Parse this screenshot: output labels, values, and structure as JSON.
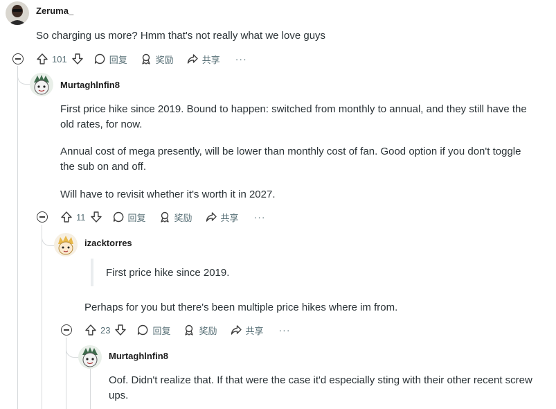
{
  "comments": [
    {
      "username": "Zeruma_",
      "paragraphs": [
        "So charging us more? Hmm that's not really what we love guys"
      ],
      "score": "101"
    },
    {
      "username": "Murtaghlnfin8",
      "paragraphs": [
        "First price hike since 2019. Bound to happen: switched from monthly to annual, and they still have the",
        "old rates, for now.",
        "Annual cost of mega presently, will be lower than monthly cost of fan. Good option if you don't toggle",
        "the sub on and off.",
        "Will have to revisit whether it's worth it in 2027."
      ],
      "score": "11"
    },
    {
      "username": "izacktorres",
      "quote": "First price hike since 2019.",
      "paragraphs": [
        "Perhaps for you but there's been multiple price hikes where im from."
      ],
      "score": "23"
    },
    {
      "username": "Murtaghlnfin8",
      "paragraphs": [
        "Oof. Didn't realize that. If that were the case it'd especially sting with their other recent screw",
        "ups."
      ]
    }
  ],
  "actions": {
    "reply": "回复",
    "award": "奖励",
    "share": "共享",
    "more": "···"
  },
  "icons": [
    "upvote-icon",
    "downvote-icon",
    "reply-icon",
    "award-icon",
    "share-icon",
    "collapse-icon"
  ]
}
